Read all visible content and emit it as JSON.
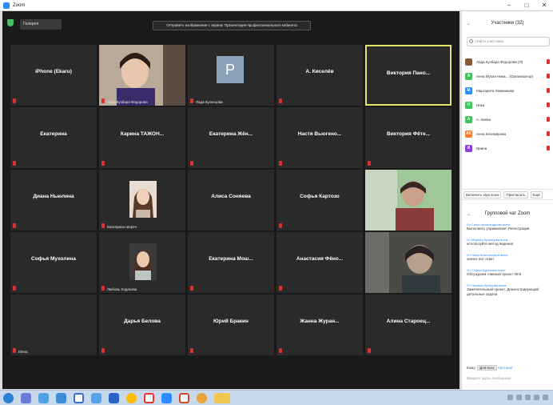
{
  "window": {
    "title": "Zoom",
    "controls": [
      "–",
      "□",
      "✕"
    ]
  },
  "topbar": {
    "view_label": "Галерея",
    "banner": "Отправить изображение с экрана: Презентация профессионального кабинета"
  },
  "tiles": [
    {
      "name": "iPhone (Ekaru)",
      "sub": ""
    },
    {
      "name": "",
      "sub": "Лада Кузбара Федорова"
    },
    {
      "name": "P",
      "sub": "Лада Кузнецова"
    },
    {
      "name": "А. Киселёв",
      "sub": ""
    },
    {
      "name": "Виктория Пано...",
      "sub": ""
    },
    {
      "name": "Екатерина",
      "sub": ""
    },
    {
      "name": "Карина ТАЖОН...",
      "sub": ""
    },
    {
      "name": "Екатерина Жён...",
      "sub": ""
    },
    {
      "name": "Настя Вьюгено...",
      "sub": ""
    },
    {
      "name": "Виктория Фёте...",
      "sub": ""
    },
    {
      "name": "Диана Ньюлина",
      "sub": ""
    },
    {
      "name": "",
      "sub": "Екатерина Шереч"
    },
    {
      "name": "Алиса Соняева",
      "sub": ""
    },
    {
      "name": "Софья Картозо",
      "sub": ""
    },
    {
      "name": "",
      "sub": ""
    },
    {
      "name": "Софья Мухолина",
      "sub": ""
    },
    {
      "name": "",
      "sub": "Любовь Ходякова"
    },
    {
      "name": "Екатерина Мош...",
      "sub": ""
    },
    {
      "name": "Анастасия Фёно...",
      "sub": ""
    },
    {
      "name": "",
      "sub": ""
    },
    {
      "name": "",
      "sub": "Elena"
    },
    {
      "name": "Дарья Белова",
      "sub": ""
    },
    {
      "name": "Юрий Бракин",
      "sub": ""
    },
    {
      "name": "Жанна Журан...",
      "sub": ""
    },
    {
      "name": "Алина Староец...",
      "sub": ""
    }
  ],
  "panel": {
    "title": "Участники (32)",
    "search_placeholder": "Найти участника",
    "participants": [
      {
        "name": "Лада Кузбара Федорова (Я)",
        "color": "#8b5a3c",
        "initial": ""
      },
      {
        "name": "Анна Мухая Ника... (Организатор)",
        "color": "#43c35e",
        "initial": "А"
      },
      {
        "name": "Маргарита Люмникова",
        "color": "#2d8cff",
        "initial": "М"
      },
      {
        "name": "Ника",
        "color": "#43c35e",
        "initial": "Н"
      },
      {
        "name": "А. Каёва",
        "color": "#43c35e",
        "initial": "А"
      },
      {
        "name": "Анна Кесемерова",
        "color": "#ff7a2f",
        "initial": "АК"
      },
      {
        "name": "Ирина",
        "color": "#8b3fd9",
        "initial": "И"
      }
    ],
    "buttons": [
      "Включить звук всем",
      "Пригласить",
      "Ещё"
    ],
    "chat_title": "Групповой чат Zoom",
    "chat": [
      {
        "from": "От Сажа Александрова всем:",
        "text": "Выполнить упражнение: Регистрация"
      },
      {
        "from": "От Марина Кузнецова всем:",
        "text": "используйте метод ведения"
      },
      {
        "from": "От Нина Анатольевна всем:",
        "text": "значит вот ответ"
      },
      {
        "from": "От Софья Буринова всем:",
        "text": "Обсуждаем главный проект IIIIIII"
      },
      {
        "from": "От Наташа Кучерова всем:",
        "text": "Замечательный проект. Демонстрирующий детальные задачи"
      }
    ],
    "to_label": "Кому:",
    "to_value": "Для всех",
    "to_more": "Частный",
    "input_placeholder": "Введите здесь сообщение..."
  },
  "colors": {
    "tile_bg": "#2a2a2a",
    "active_border": "#e6e36c",
    "muted": "#e02f2f"
  }
}
